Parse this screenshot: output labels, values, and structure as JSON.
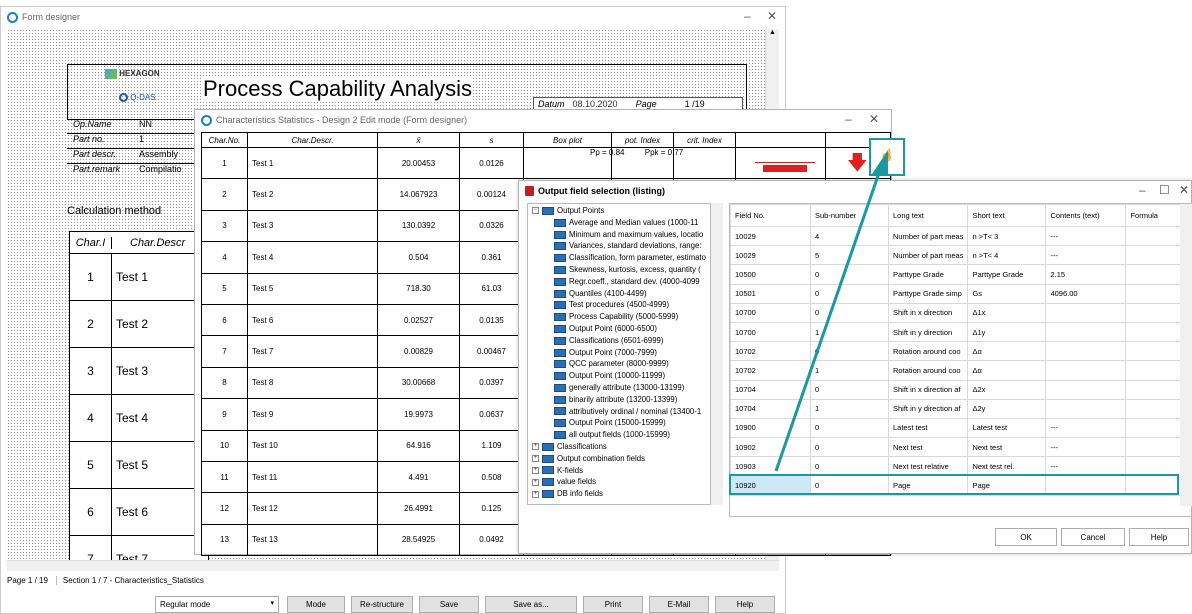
{
  "form_designer": {
    "title": "Form designer",
    "status": "Page 1 / 19",
    "section": "Section 1 / 7 - Characteristics_Statistics",
    "mode_value": "Regular mode",
    "buttons": [
      "Mode",
      "Re-structure",
      "Save",
      "Save as...",
      "Print",
      "E-Mail",
      "Help"
    ]
  },
  "report": {
    "logo": "HEXAGON",
    "logo_sub": "Q-DAS",
    "title": "Process Capability Analysis",
    "datum_label": "Datum",
    "datum_value": "08.10.2020",
    "page_label": "Page",
    "page_value": "1 /19",
    "fields": [
      {
        "label": "Op.Name",
        "value": "NN"
      },
      {
        "label": "Part no.",
        "value": "1"
      },
      {
        "label": "Part descr.",
        "value": "Assembly"
      },
      {
        "label": "Part.remark",
        "value": "Compilatio"
      }
    ],
    "calc_method": "Calculation method",
    "col_char": "Char.I",
    "col_descr": "Char.Descr",
    "rows": [
      {
        "n": "1",
        "t": "Test 1"
      },
      {
        "n": "2",
        "t": "Test 2"
      },
      {
        "n": "3",
        "t": "Test 3"
      },
      {
        "n": "4",
        "t": "Test 4"
      },
      {
        "n": "5",
        "t": "Test 5"
      },
      {
        "n": "6",
        "t": "Test 6"
      },
      {
        "n": "7",
        "t": "Test 7"
      }
    ]
  },
  "char_stats": {
    "title": "Characteristics Statistics - Design 2 Edit mode (Form designer)",
    "headers": [
      "Char.No.",
      "Char.Descr.",
      "x̄",
      "s",
      "Box plot",
      "pot. Index",
      "crit. Index"
    ],
    "pot_label": "Pp",
    "pot_value": "= 0.84",
    "crit_label": "Ppk",
    "crit_value": "= 0.77",
    "rows": [
      [
        "1",
        "Test 1",
        "20.00453",
        "0.0126"
      ],
      [
        "2",
        "Test 2",
        "14.067923",
        "0.00124"
      ],
      [
        "3",
        "Test 3",
        "130.0392",
        "0.0326"
      ],
      [
        "4",
        "Test 4",
        "0.504",
        "0.361"
      ],
      [
        "5",
        "Test 5",
        "718.30",
        "61.03"
      ],
      [
        "6",
        "Test 6",
        "0.02527",
        "0.0135"
      ],
      [
        "7",
        "Test 7",
        "0.00829",
        "0.00467"
      ],
      [
        "8",
        "Test 8",
        "30.00668",
        "0.0397"
      ],
      [
        "9",
        "Test 9",
        "19.9973",
        "0.0637"
      ],
      [
        "10",
        "Test 10",
        "64.916",
        "1.109"
      ],
      [
        "11",
        "Test 11",
        "4.491",
        "0.508"
      ],
      [
        "12",
        "Test 12",
        "26.4991",
        "0.125"
      ],
      [
        "13",
        "Test 13",
        "28.54925",
        "0.0492"
      ]
    ]
  },
  "output_sel": {
    "title": "Output field selection (listing)",
    "tree": [
      {
        "l": "Output Points",
        "d": 1,
        "ex": "−"
      },
      {
        "l": "Average and Median values (1000-11",
        "d": 2
      },
      {
        "l": "Minimum and maximum values, locatio",
        "d": 2
      },
      {
        "l": "Variances, standard deviations, range:",
        "d": 2
      },
      {
        "l": "Classification, form parameter, estimato",
        "d": 2
      },
      {
        "l": "Skewness, kurtosis, excess, quantity (",
        "d": 2
      },
      {
        "l": "Regr.coeff., standard dev. (4000-4099",
        "d": 2
      },
      {
        "l": "Quantiles (4100-4499)",
        "d": 2
      },
      {
        "l": "Test procedures (4500-4999)",
        "d": 2
      },
      {
        "l": "Process Capability (5000-5999)",
        "d": 2
      },
      {
        "l": "Output Point (6000-6500)",
        "d": 2
      },
      {
        "l": "Classifications (6501-6999)",
        "d": 2
      },
      {
        "l": "Output Point (7000-7999)",
        "d": 2
      },
      {
        "l": "QCC parameter (8000-9999)",
        "d": 2
      },
      {
        "l": "Output Point (10000-11999)",
        "d": 2
      },
      {
        "l": "generally attribute (13000-13199)",
        "d": 2
      },
      {
        "l": "binarily attribute (13200-13399)",
        "d": 2
      },
      {
        "l": "attributively ordinal / nominal (13400-1",
        "d": 2
      },
      {
        "l": "Output Point (15000-15999)",
        "d": 2
      },
      {
        "l": "all output fields (1000-15999)",
        "d": 2
      },
      {
        "l": "Classifications",
        "d": 1,
        "ex": "+"
      },
      {
        "l": "Output combination fields",
        "d": 1,
        "ex": "+"
      },
      {
        "l": "K-fields",
        "d": 1,
        "ex": "+"
      },
      {
        "l": "value fields",
        "d": 1,
        "ex": "+"
      },
      {
        "l": "DB info fields",
        "d": 1,
        "ex": "+"
      }
    ],
    "headers": [
      "Field No.",
      "Sub-number",
      "Long text",
      "Short text",
      "Contents (text)",
      "Formula"
    ],
    "rows": [
      [
        "10029",
        "4",
        "Number of part meas",
        "n >T< 3",
        "---",
        ""
      ],
      [
        "10029",
        "5",
        "Number of part meas",
        "n >T< 4",
        "---",
        ""
      ],
      [
        "10500",
        "0",
        "Parttype Grade",
        "Parttype Grade",
        "2.15",
        ""
      ],
      [
        "10501",
        "0",
        "Parttype Grade simp",
        "Gs",
        "4096.00",
        ""
      ],
      [
        "10700",
        "0",
        "Shift in x direction",
        "Δ1x",
        "",
        ""
      ],
      [
        "10700",
        "1",
        "Shift in y direction",
        "Δ1y",
        "",
        ""
      ],
      [
        "10702",
        "0",
        "Rotation around coo",
        "Δα",
        "",
        ""
      ],
      [
        "10702",
        "1",
        "Rotation around coo",
        "Δα",
        "",
        ""
      ],
      [
        "10704",
        "0",
        "Shift in x direction af",
        "Δ2x",
        "",
        ""
      ],
      [
        "10704",
        "1",
        "Shift in y direction af",
        "Δ2y",
        "",
        ""
      ],
      [
        "10900",
        "0",
        "Latest test",
        "Latest test",
        "---",
        ""
      ],
      [
        "10902",
        "0",
        "Next test",
        "Next test",
        "---",
        ""
      ],
      [
        "10903",
        "0",
        "Next test relative",
        "Next test rel.",
        "---",
        ""
      ],
      [
        "10920",
        "0",
        "Page",
        "Page",
        "",
        ""
      ]
    ],
    "ok": "OK",
    "cancel": "Cancel",
    "help": "Help"
  },
  "colors": {
    "accent": "#1a9aa0",
    "highlight": "#cde8f7",
    "red": "#e02020"
  }
}
